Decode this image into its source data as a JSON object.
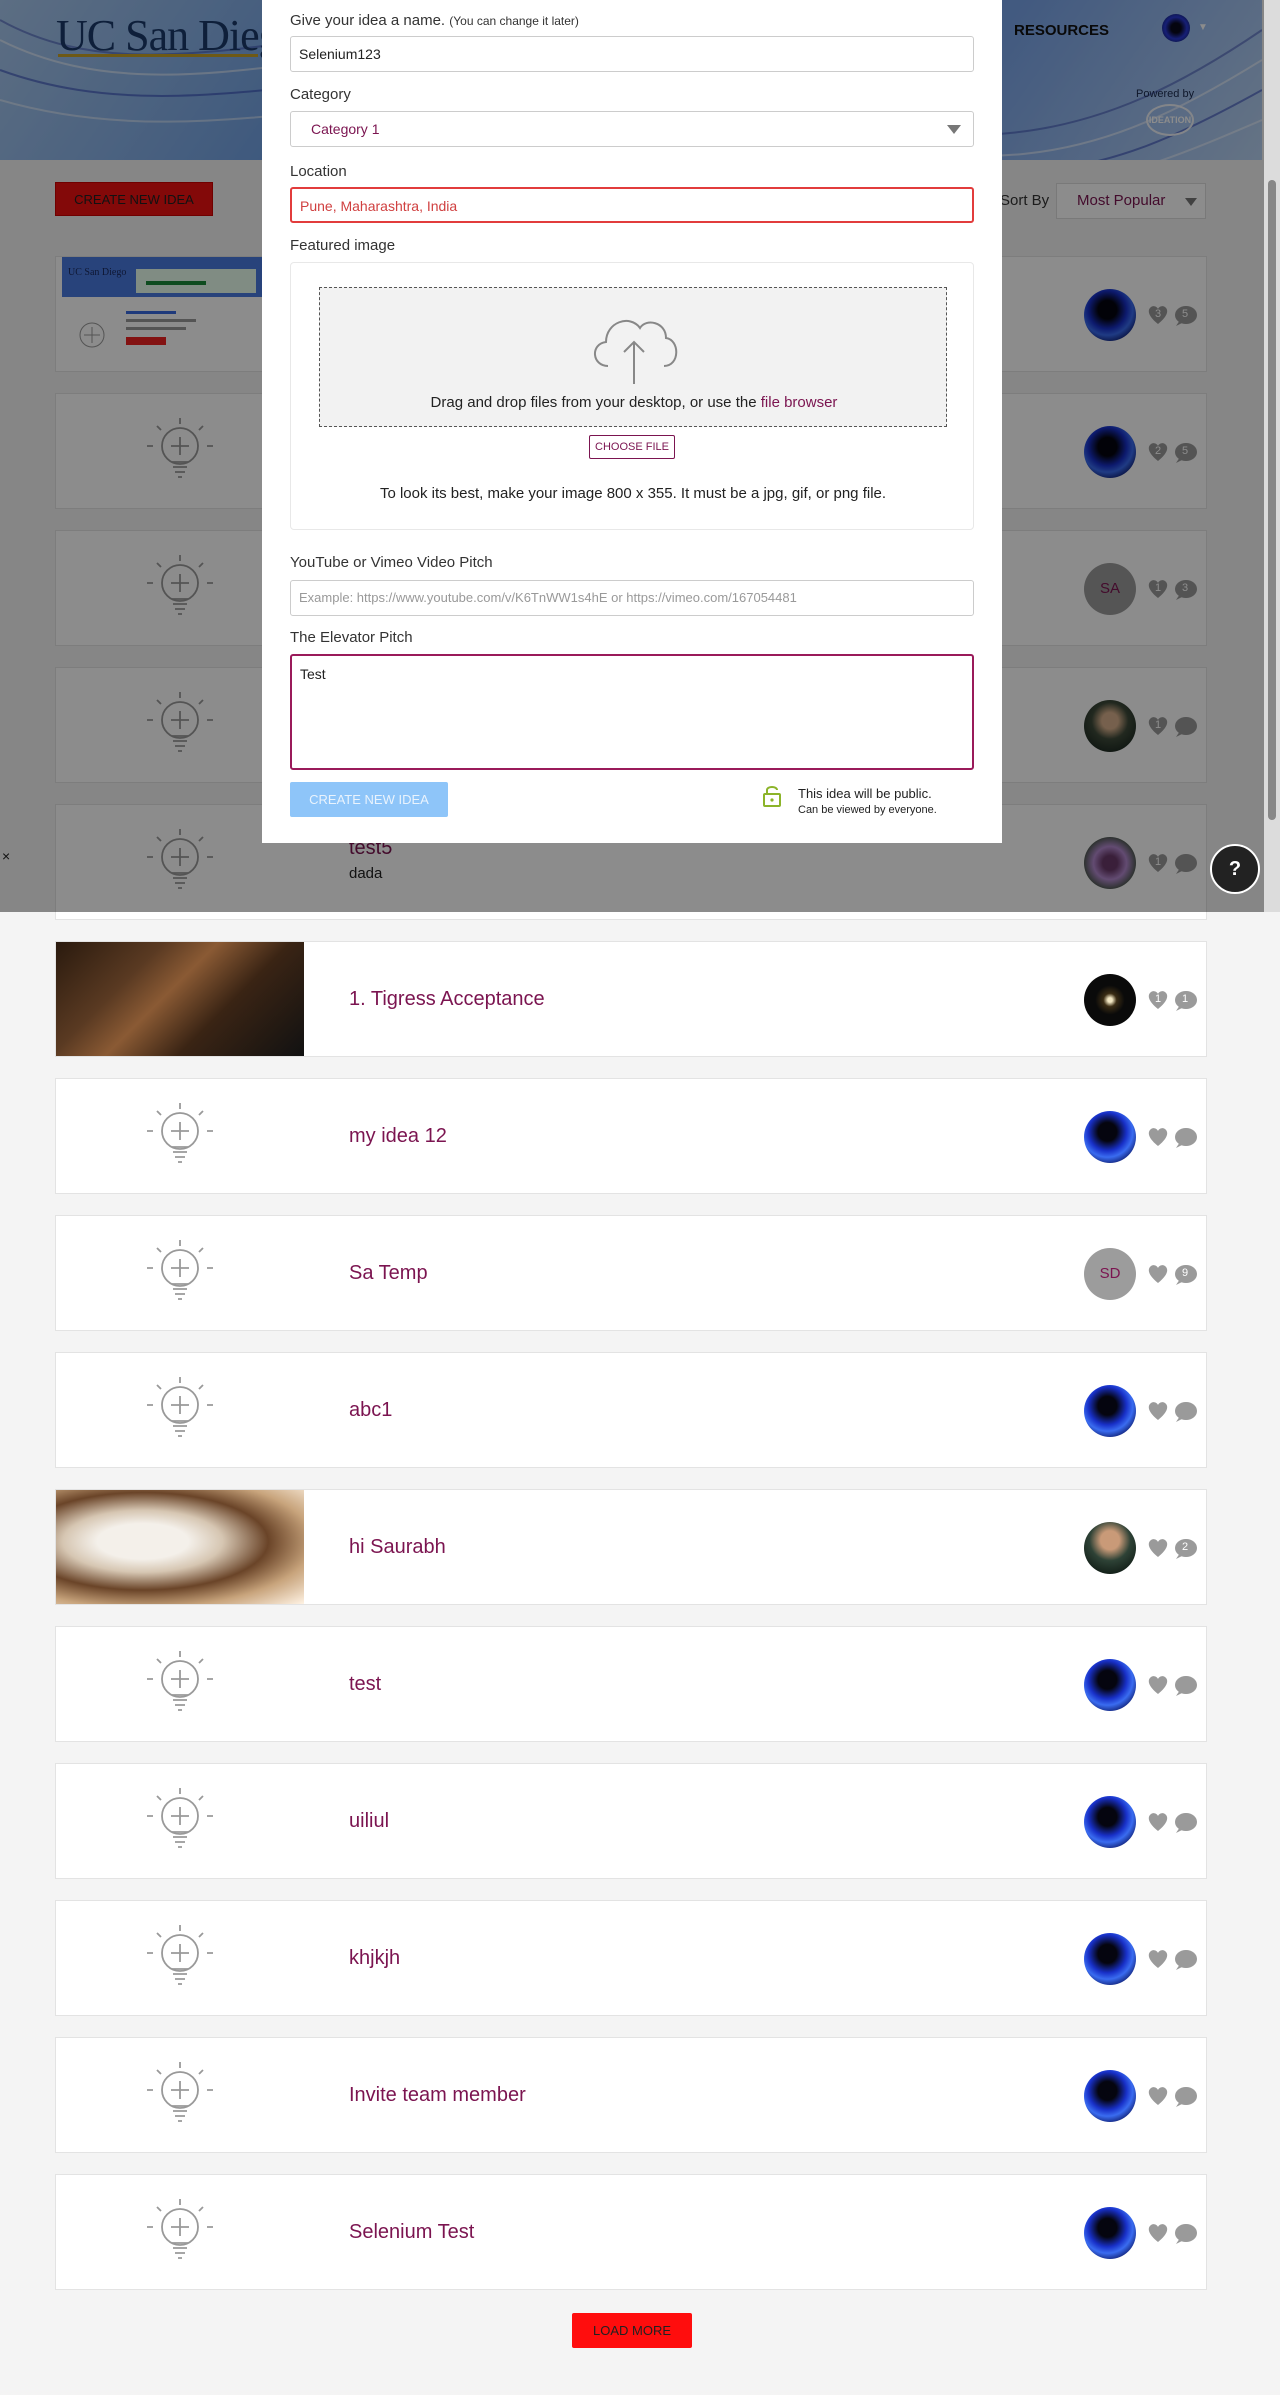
{
  "header": {
    "logo_text": "UC San Diego",
    "nav_resources": "RESOURCES",
    "powered_by": "Powered by",
    "powered_logo": "IDEATION"
  },
  "toolbar": {
    "create_label": "CREATE NEW IDEA",
    "sort_label": "Sort By",
    "sort_value": "Most Popular"
  },
  "ideas": [
    {
      "title": "",
      "description": "",
      "avatar": "",
      "likes": "3",
      "comments": "5",
      "thumb": "screenshot"
    },
    {
      "title": "",
      "description": "",
      "avatar": "",
      "likes": "2",
      "comments": "5",
      "thumb": "bulb"
    },
    {
      "title": "",
      "description": "",
      "avatar": "SA",
      "likes": "1",
      "comments": "3",
      "thumb": "bulb"
    },
    {
      "title": "",
      "description": "",
      "avatar": "",
      "likes": "1",
      "comments": "",
      "thumb": "bulb"
    },
    {
      "title": "test5",
      "description": "dada",
      "avatar": "",
      "likes": "1",
      "comments": "",
      "thumb": "bulb"
    },
    {
      "title": "1. Tigress Acceptance",
      "description": "",
      "avatar": "",
      "likes": "1",
      "comments": "1",
      "thumb": "coffee"
    },
    {
      "title": "my idea 12",
      "description": "",
      "avatar": "",
      "likes": "",
      "comments": "",
      "thumb": "bulb"
    },
    {
      "title": "Sa Temp",
      "description": "",
      "avatar": "SD",
      "likes": "",
      "comments": "9",
      "thumb": "bulb"
    },
    {
      "title": "abc1",
      "description": "",
      "avatar": "",
      "likes": "",
      "comments": "",
      "thumb": "bulb"
    },
    {
      "title": "hi Saurabh",
      "description": "",
      "avatar": "",
      "likes": "",
      "comments": "2",
      "thumb": "cup"
    },
    {
      "title": "test",
      "description": "",
      "avatar": "",
      "likes": "",
      "comments": "",
      "thumb": "bulb"
    },
    {
      "title": "uiliul",
      "description": "",
      "avatar": "",
      "likes": "",
      "comments": "",
      "thumb": "bulb"
    },
    {
      "title": "khjkjh",
      "description": "",
      "avatar": "",
      "likes": "",
      "comments": "",
      "thumb": "bulb"
    },
    {
      "title": "Invite team member",
      "description": "",
      "avatar": "",
      "likes": "",
      "comments": "",
      "thumb": "bulb"
    },
    {
      "title": "Selenium Test",
      "description": "",
      "avatar": "",
      "likes": "",
      "comments": "",
      "thumb": "bulb"
    }
  ],
  "modal": {
    "name_label": "Give your idea a name.",
    "name_hint": "(You can change it later)",
    "name_value": "Selenium123",
    "category_label": "Category",
    "category_value": "Category 1",
    "location_label": "Location",
    "location_value": "Pune, Maharashtra, India",
    "featured_label": "Featured image",
    "drop_text": "Drag and drop files from your desktop, or use the",
    "drop_link": "file browser",
    "choose_file": "CHOOSE FILE",
    "image_hint": "To look its best, make your image 800 x 355. It must be a jpg, gif, or png file.",
    "video_label": "YouTube or Vimeo Video Pitch",
    "video_placeholder": "Example: https://www.youtube.com/v/K6TnWW1s4hE or https://vimeo.com/167054481",
    "pitch_label": "The Elevator Pitch",
    "pitch_value": "Test",
    "submit_label": "CREATE NEW IDEA",
    "public_title": "This idea will be public.",
    "public_sub": "Can be viewed by everyone."
  },
  "overlay_close": "×",
  "help_label": "?",
  "load_more": "LOAD MORE",
  "colors": {
    "accent": "#7b1450",
    "button_red": "#ee1111",
    "submit_disabled": "#8ec5f9"
  }
}
